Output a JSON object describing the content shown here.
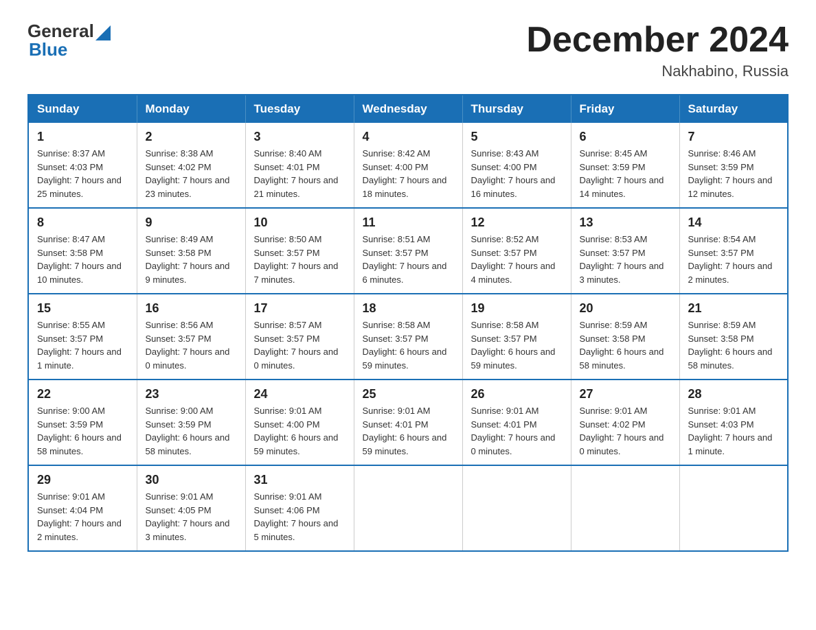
{
  "header": {
    "logo_general": "General",
    "logo_blue": "Blue",
    "title": "December 2024",
    "subtitle": "Nakhabino, Russia"
  },
  "days_of_week": [
    "Sunday",
    "Monday",
    "Tuesday",
    "Wednesday",
    "Thursday",
    "Friday",
    "Saturday"
  ],
  "weeks": [
    [
      {
        "day": "1",
        "sunrise": "8:37 AM",
        "sunset": "4:03 PM",
        "daylight": "7 hours and 25 minutes."
      },
      {
        "day": "2",
        "sunrise": "8:38 AM",
        "sunset": "4:02 PM",
        "daylight": "7 hours and 23 minutes."
      },
      {
        "day": "3",
        "sunrise": "8:40 AM",
        "sunset": "4:01 PM",
        "daylight": "7 hours and 21 minutes."
      },
      {
        "day": "4",
        "sunrise": "8:42 AM",
        "sunset": "4:00 PM",
        "daylight": "7 hours and 18 minutes."
      },
      {
        "day": "5",
        "sunrise": "8:43 AM",
        "sunset": "4:00 PM",
        "daylight": "7 hours and 16 minutes."
      },
      {
        "day": "6",
        "sunrise": "8:45 AM",
        "sunset": "3:59 PM",
        "daylight": "7 hours and 14 minutes."
      },
      {
        "day": "7",
        "sunrise": "8:46 AM",
        "sunset": "3:59 PM",
        "daylight": "7 hours and 12 minutes."
      }
    ],
    [
      {
        "day": "8",
        "sunrise": "8:47 AM",
        "sunset": "3:58 PM",
        "daylight": "7 hours and 10 minutes."
      },
      {
        "day": "9",
        "sunrise": "8:49 AM",
        "sunset": "3:58 PM",
        "daylight": "7 hours and 9 minutes."
      },
      {
        "day": "10",
        "sunrise": "8:50 AM",
        "sunset": "3:57 PM",
        "daylight": "7 hours and 7 minutes."
      },
      {
        "day": "11",
        "sunrise": "8:51 AM",
        "sunset": "3:57 PM",
        "daylight": "7 hours and 6 minutes."
      },
      {
        "day": "12",
        "sunrise": "8:52 AM",
        "sunset": "3:57 PM",
        "daylight": "7 hours and 4 minutes."
      },
      {
        "day": "13",
        "sunrise": "8:53 AM",
        "sunset": "3:57 PM",
        "daylight": "7 hours and 3 minutes."
      },
      {
        "day": "14",
        "sunrise": "8:54 AM",
        "sunset": "3:57 PM",
        "daylight": "7 hours and 2 minutes."
      }
    ],
    [
      {
        "day": "15",
        "sunrise": "8:55 AM",
        "sunset": "3:57 PM",
        "daylight": "7 hours and 1 minute."
      },
      {
        "day": "16",
        "sunrise": "8:56 AM",
        "sunset": "3:57 PM",
        "daylight": "7 hours and 0 minutes."
      },
      {
        "day": "17",
        "sunrise": "8:57 AM",
        "sunset": "3:57 PM",
        "daylight": "7 hours and 0 minutes."
      },
      {
        "day": "18",
        "sunrise": "8:58 AM",
        "sunset": "3:57 PM",
        "daylight": "6 hours and 59 minutes."
      },
      {
        "day": "19",
        "sunrise": "8:58 AM",
        "sunset": "3:57 PM",
        "daylight": "6 hours and 59 minutes."
      },
      {
        "day": "20",
        "sunrise": "8:59 AM",
        "sunset": "3:58 PM",
        "daylight": "6 hours and 58 minutes."
      },
      {
        "day": "21",
        "sunrise": "8:59 AM",
        "sunset": "3:58 PM",
        "daylight": "6 hours and 58 minutes."
      }
    ],
    [
      {
        "day": "22",
        "sunrise": "9:00 AM",
        "sunset": "3:59 PM",
        "daylight": "6 hours and 58 minutes."
      },
      {
        "day": "23",
        "sunrise": "9:00 AM",
        "sunset": "3:59 PM",
        "daylight": "6 hours and 58 minutes."
      },
      {
        "day": "24",
        "sunrise": "9:01 AM",
        "sunset": "4:00 PM",
        "daylight": "6 hours and 59 minutes."
      },
      {
        "day": "25",
        "sunrise": "9:01 AM",
        "sunset": "4:01 PM",
        "daylight": "6 hours and 59 minutes."
      },
      {
        "day": "26",
        "sunrise": "9:01 AM",
        "sunset": "4:01 PM",
        "daylight": "7 hours and 0 minutes."
      },
      {
        "day": "27",
        "sunrise": "9:01 AM",
        "sunset": "4:02 PM",
        "daylight": "7 hours and 0 minutes."
      },
      {
        "day": "28",
        "sunrise": "9:01 AM",
        "sunset": "4:03 PM",
        "daylight": "7 hours and 1 minute."
      }
    ],
    [
      {
        "day": "29",
        "sunrise": "9:01 AM",
        "sunset": "4:04 PM",
        "daylight": "7 hours and 2 minutes."
      },
      {
        "day": "30",
        "sunrise": "9:01 AM",
        "sunset": "4:05 PM",
        "daylight": "7 hours and 3 minutes."
      },
      {
        "day": "31",
        "sunrise": "9:01 AM",
        "sunset": "4:06 PM",
        "daylight": "7 hours and 5 minutes."
      },
      null,
      null,
      null,
      null
    ]
  ]
}
